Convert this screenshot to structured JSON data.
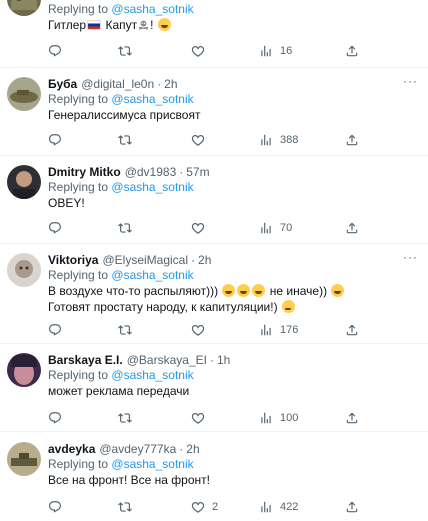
{
  "tweets": [
    {
      "replying_label": "Replying to",
      "replying_to": "@sasha_sotnik",
      "text_before": "Гитлер",
      "text_after": "Капут",
      "text_end": "!",
      "counts": {
        "views": "16"
      }
    },
    {
      "name": "Буба",
      "handle": "@digital_le0n",
      "dot": "·",
      "time": "2h",
      "more": "···",
      "replying_label": "Replying to",
      "replying_to": "@sasha_sotnik",
      "text": "Генералиссимуса присвоят",
      "counts": {
        "views": "388"
      }
    },
    {
      "name": "Dmitry Mitko",
      "handle": "@dv1983",
      "dot": "·",
      "time": "57m",
      "replying_label": "Replying to",
      "replying_to": "@sasha_sotnik",
      "text": "OBEY!",
      "counts": {
        "views": "70"
      }
    },
    {
      "name": "Viktoriya",
      "handle": "@ElyseiMagical",
      "dot": "·",
      "time": "2h",
      "more": "···",
      "replying_label": "Replying to",
      "replying_to": "@sasha_sotnik",
      "text_line1_a": "В воздухе что-то распыляют)))",
      "text_line1_b": "не иначе))",
      "text_line2": "Готовят простату народу, к капитуляции!)",
      "counts": {
        "views": "176"
      }
    },
    {
      "name": "Barskaya E.I.",
      "handle": "@Barskaya_EI",
      "dot": "·",
      "time": "1h",
      "replying_label": "Replying to",
      "replying_to": "@sasha_sotnik",
      "text": "может реклама передачи",
      "counts": {
        "views": "100"
      }
    },
    {
      "name": "avdeyka",
      "handle": "@avdey777ka",
      "dot": "·",
      "time": "2h",
      "replying_label": "Replying to",
      "replying_to": "@sasha_sotnik",
      "text": "Все на фронт! Все на фронт!",
      "counts": {
        "likes": "2",
        "views": "422"
      }
    }
  ],
  "colors": {
    "link": "#1d9bf0",
    "muted": "#536471",
    "text": "#0f1419",
    "divider": "#eff3f4"
  },
  "icons": [
    "reply-icon",
    "retweet-icon",
    "like-icon",
    "views-icon",
    "share-icon",
    "more-icon"
  ]
}
